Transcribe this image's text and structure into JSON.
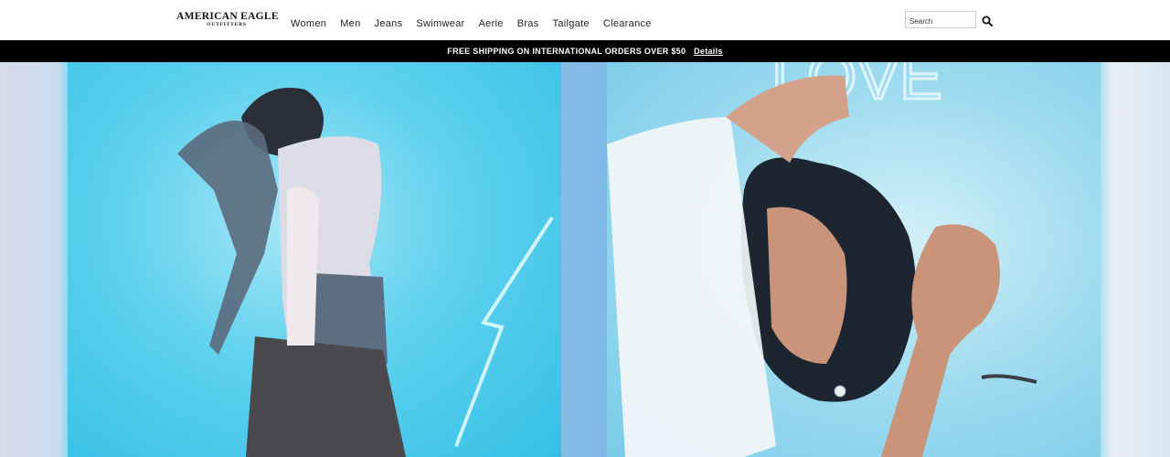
{
  "brand": {
    "name": "AMERICAN EAGLE",
    "sub": "OUTFITTERS"
  },
  "nav": {
    "items": [
      {
        "label": "Women"
      },
      {
        "label": "Men"
      },
      {
        "label": "Jeans"
      },
      {
        "label": "Swimwear"
      },
      {
        "label": "Aerie"
      },
      {
        "label": "Bras"
      },
      {
        "label": "Tailgate"
      },
      {
        "label": "Clearance"
      }
    ]
  },
  "search": {
    "placeholder": "Search",
    "icon": "search-icon"
  },
  "promo": {
    "text": "FREE SHIPPING ON INTERNATIONAL ORDERS OVER $50",
    "link": "Details"
  },
  "hero": {
    "images": [
      {
        "subject": "hero-image-men"
      },
      {
        "subject": "hero-image-women"
      }
    ]
  },
  "colors": {
    "promo_bg": "#000000",
    "accent": "#4fc9ea"
  }
}
